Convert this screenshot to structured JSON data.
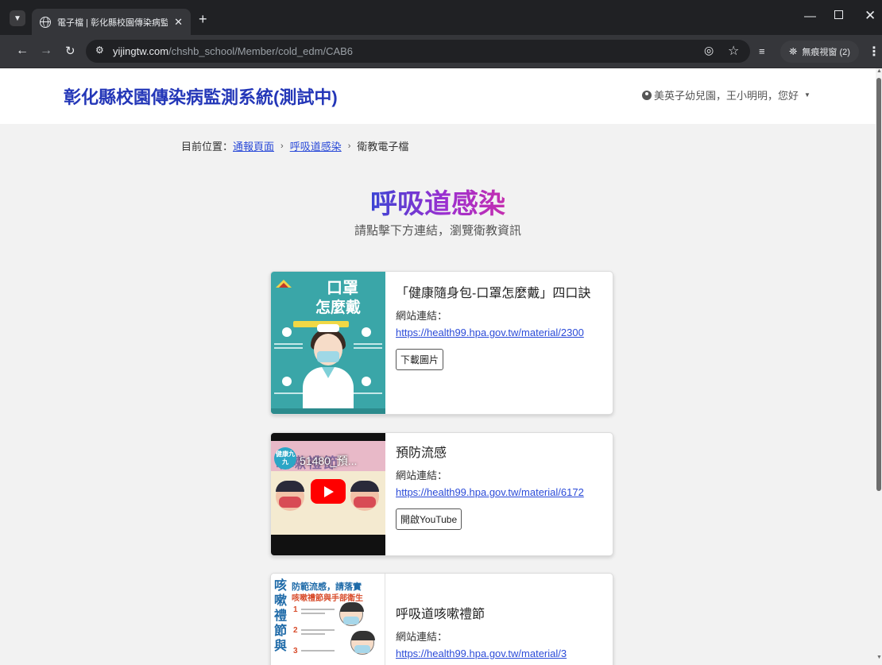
{
  "browser": {
    "tab_title": "電子檔 | 彰化縣校園傳染病監測",
    "url_host": "yijingtw.com",
    "url_path": "/chshb_school/Member/cold_edm/CAB6",
    "incognito_label": "無痕視窗 (2)"
  },
  "header": {
    "site_title": "彰化縣校園傳染病監測系統(測試中)",
    "user_greeting": "美英子幼兒園，王小明明，您好"
  },
  "breadcrumb": {
    "prefix": "目前位置：",
    "items": [
      "通報頁面",
      "呼吸道感染"
    ],
    "current": "衛教電子檔"
  },
  "hero": {
    "title": "呼吸道感染",
    "subtitle": "請點擊下方連結，瀏覽衛教資訊"
  },
  "cards": [
    {
      "title": "「健康隨身包-口罩怎麼戴」四口訣",
      "link_label": "網站連結：",
      "link": "https://health99.hpa.gov.tw/material/2300",
      "button": "下載圖片",
      "image_text_1": "口罩",
      "image_text_2": "怎麼戴"
    },
    {
      "title": "預防流感",
      "link_label": "網站連結：",
      "link": "https://health99.hpa.gov.tw/material/6172",
      "button": "開啟YouTube",
      "video_title": "51480_預...",
      "video_logo": "健康九九"
    },
    {
      "title": "呼吸道咳嗽禮節",
      "link_label": "網站連結：",
      "link": "https://health99.hpa.gov.tw/material/3",
      "image_text_col": [
        "咳",
        "嗽",
        "禮",
        "節",
        "與"
      ],
      "image_head_1": "防範流感，請落實",
      "image_head_2": "咳嗽禮節與手部衛生"
    }
  ]
}
